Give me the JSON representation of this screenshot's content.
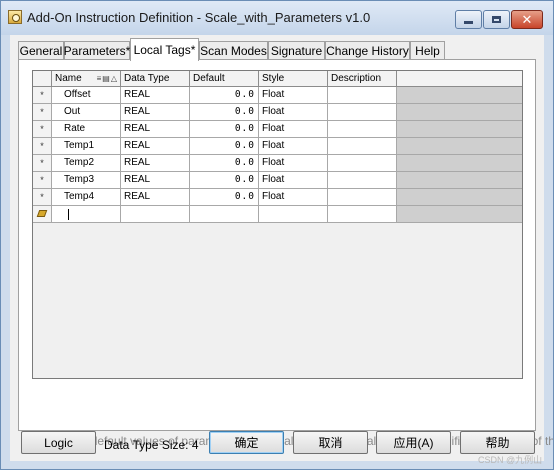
{
  "window": {
    "title": "Add-On Instruction Definition - Scale_with_Parameters v1.0",
    "minimize_glyph": "",
    "maximize_glyph": "",
    "close_glyph": "✕"
  },
  "tabs": [
    {
      "label": "General"
    },
    {
      "label": "Parameters*"
    },
    {
      "label": "Local Tags*"
    },
    {
      "label": "Scan Modes"
    },
    {
      "label": "Signature"
    },
    {
      "label": "Change History"
    },
    {
      "label": "Help"
    }
  ],
  "active_tab": "Local Tags*",
  "grid": {
    "columns": [
      "Name",
      "Data Type",
      "Default",
      "Style",
      "Description"
    ],
    "name_sort_glyphs": "≡▤△",
    "rows": [
      {
        "marker": "*",
        "name": "Offset",
        "type": "REAL",
        "default": "0.0",
        "style": "Float",
        "description": ""
      },
      {
        "marker": "*",
        "name": "Out",
        "type": "REAL",
        "default": "0.0",
        "style": "Float",
        "description": ""
      },
      {
        "marker": "*",
        "name": "Rate",
        "type": "REAL",
        "default": "0.0",
        "style": "Float",
        "description": ""
      },
      {
        "marker": "*",
        "name": "Temp1",
        "type": "REAL",
        "default": "0.0",
        "style": "Float",
        "description": ""
      },
      {
        "marker": "*",
        "name": "Temp2",
        "type": "REAL",
        "default": "0.0",
        "style": "Float",
        "description": ""
      },
      {
        "marker": "*",
        "name": "Temp3",
        "type": "REAL",
        "default": "0.0",
        "style": "Float",
        "description": ""
      },
      {
        "marker": "*",
        "name": "Temp4",
        "type": "REAL",
        "default": "0.0",
        "style": "Float",
        "description": ""
      }
    ],
    "new_row_icon": "pencil-icon"
  },
  "copy_defaults_label": "Copy all default values of parameters and local tags whose values were modified to all tags of this instru",
  "buttons": {
    "logic": "Logic",
    "ok": "确定",
    "cancel": "取消",
    "apply": "应用(A)",
    "help": "帮助"
  },
  "data_type_size": "Data Type Size: 4",
  "watermark": "CSDN @九例山"
}
